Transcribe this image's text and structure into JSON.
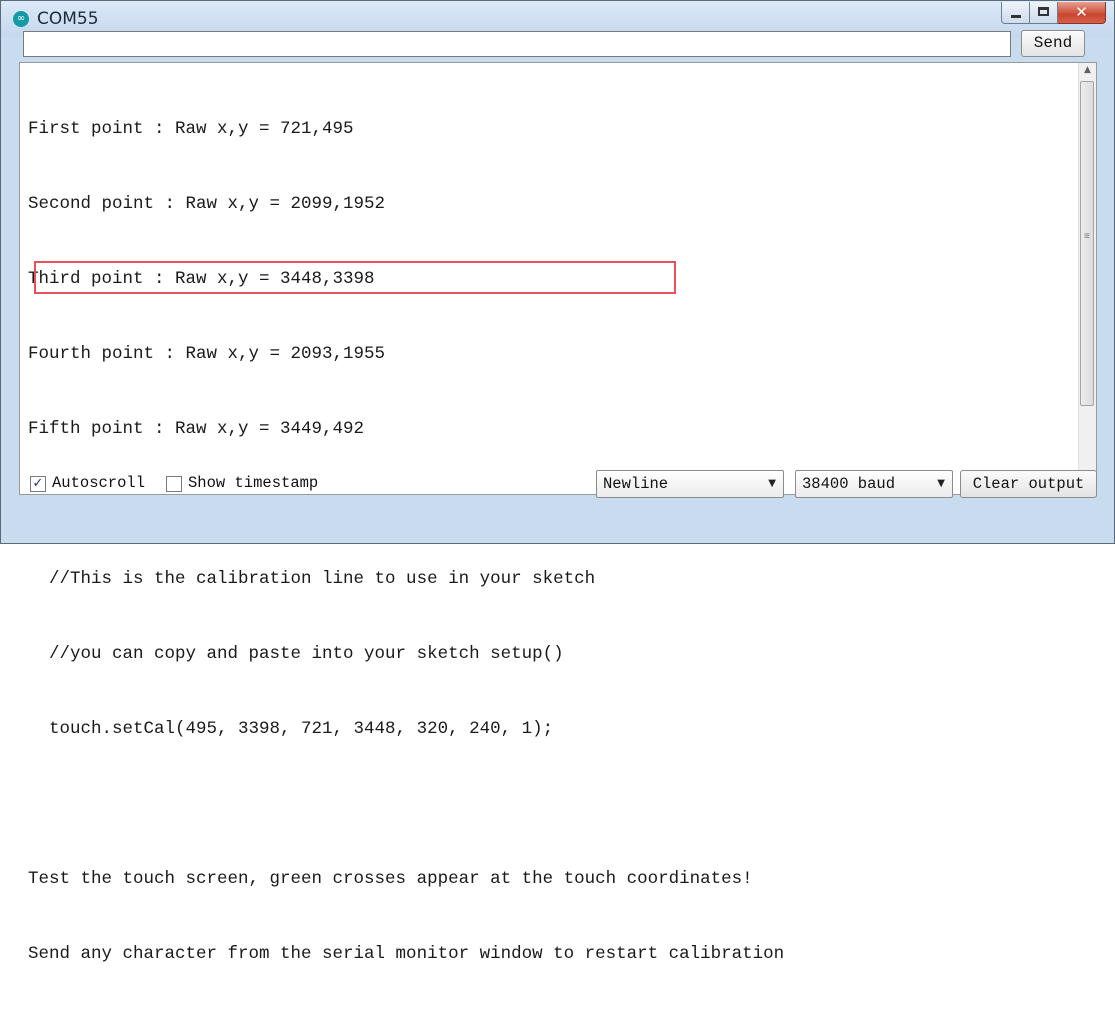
{
  "window": {
    "title": "COM55",
    "app_icon": "arduino-icon"
  },
  "input": {
    "value": "",
    "send_label": "Send"
  },
  "output": {
    "lines": [
      "First point : Raw x,y = 721,495",
      "Second point : Raw x,y = 2099,1952",
      "Third point : Raw x,y = 3448,3398",
      "Fourth point : Raw x,y = 2093,1955",
      "Fifth point : Raw x,y = 3449,492",
      "",
      "  //This is the calibration line to use in your sketch",
      "  //you can copy and paste into your sketch setup()",
      "  touch.setCal(495, 3398, 721, 3448, 320, 240, 1);",
      "",
      "Test the touch screen, green crosses appear at the touch coordinates!",
      "Send any character from the serial monitor window to restart calibration"
    ],
    "highlight_color": "#e8505b"
  },
  "footer": {
    "autoscroll_label": "Autoscroll",
    "autoscroll_checked": true,
    "timestamp_label": "Show timestamp",
    "timestamp_checked": false,
    "line_ending": "Newline",
    "baud": "38400 baud",
    "clear_label": "Clear output"
  }
}
